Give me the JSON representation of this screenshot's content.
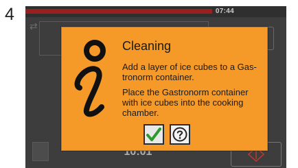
{
  "step_number": "4",
  "status_bar": {
    "time": "07:44"
  },
  "background": {
    "timer": "10:01"
  },
  "dialog": {
    "title": "Cleaning",
    "paragraph_1": "Add a layer of ice cubes to a Gas-tronorm container.",
    "paragraph_2": "Place the Gastronorm container with ice cubes into the cooking chamber.",
    "icons": {
      "info": "info-icon",
      "ok": "checkmark-icon",
      "help": "question-mark-icon"
    }
  },
  "colors": {
    "dialog_background": "#f59a28",
    "status_red": "#9a1f1f",
    "checkmark_green": "#2e9a2e",
    "screen_background": "#3d3d3d"
  }
}
